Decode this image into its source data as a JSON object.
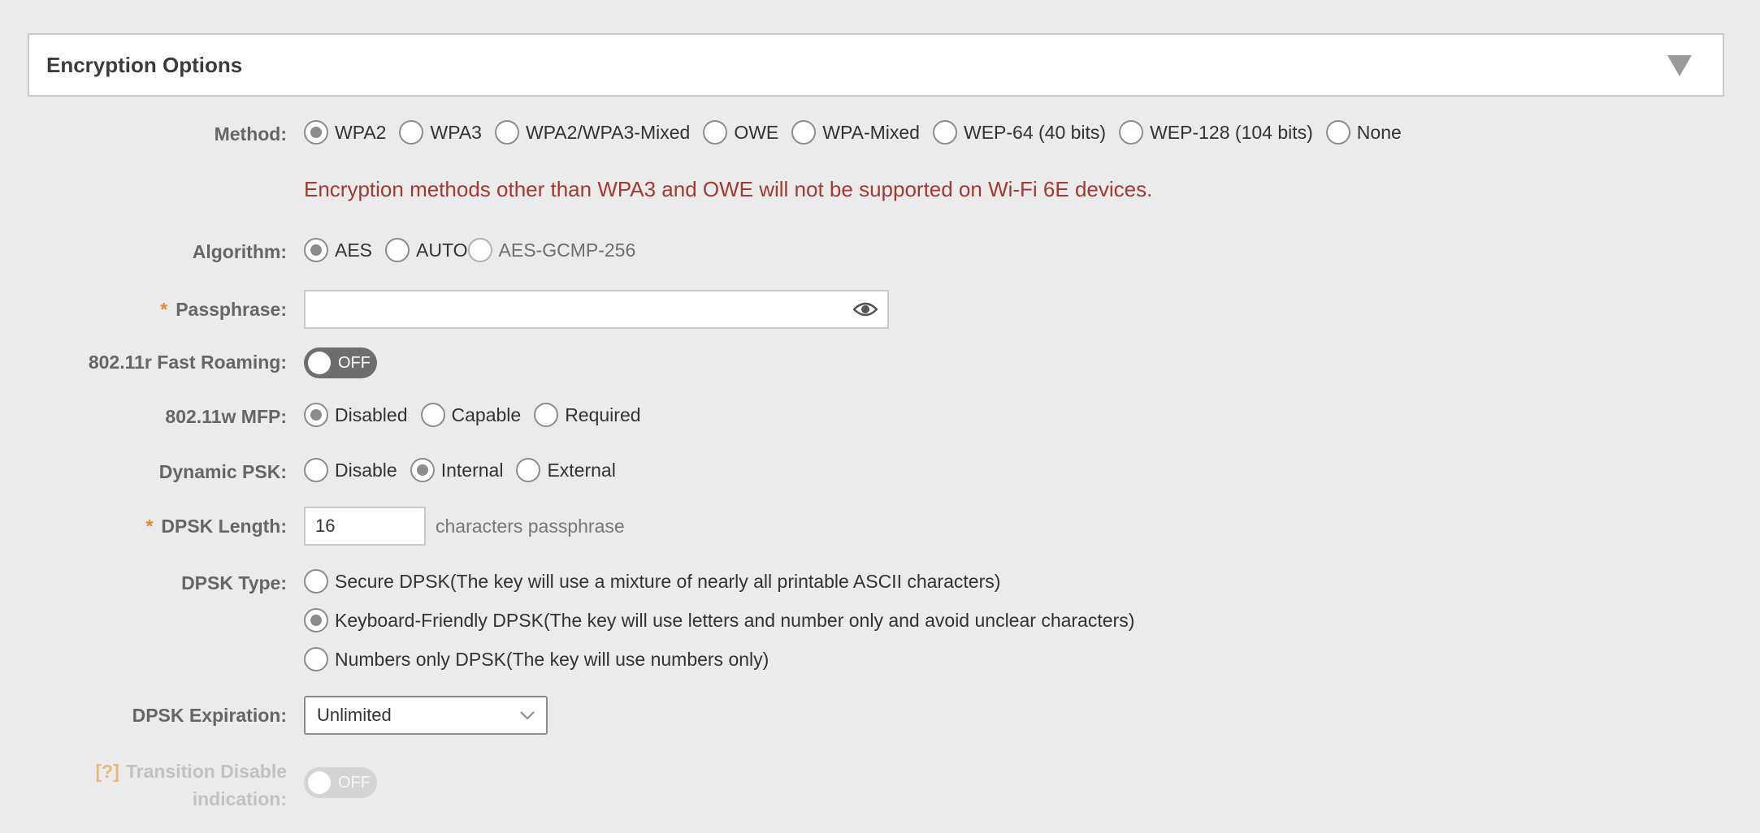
{
  "panel": {
    "title": "Encryption Options"
  },
  "method": {
    "label": "Method:",
    "options": [
      "WPA2",
      "WPA3",
      "WPA2/WPA3-Mixed",
      "OWE",
      "WPA-Mixed",
      "WEP-64 (40 bits)",
      "WEP-128 (104 bits)",
      "None"
    ],
    "selected": "WPA2"
  },
  "warning": "Encryption methods other than WPA3 and OWE will not be supported on Wi-Fi 6E devices.",
  "algorithm": {
    "label": "Algorithm:",
    "options": [
      "AES",
      "AUTO",
      "AES-GCMP-256"
    ],
    "selected": "AES"
  },
  "passphrase": {
    "required_mark": "*",
    "label": "Passphrase:",
    "value": ""
  },
  "fast_roaming": {
    "label": "802.11r Fast Roaming:",
    "state": "OFF"
  },
  "mfp": {
    "label": "802.11w MFP:",
    "options": [
      "Disabled",
      "Capable",
      "Required"
    ],
    "selected": "Disabled"
  },
  "dynamic_psk": {
    "label": "Dynamic PSK:",
    "options": [
      "Disable",
      "Internal",
      "External"
    ],
    "selected": "Internal"
  },
  "dpsk_length": {
    "required_mark": "*",
    "label": "DPSK Length:",
    "value": "16",
    "hint": "characters passphrase"
  },
  "dpsk_type": {
    "label": "DPSK Type:",
    "options": [
      "Secure DPSK(The key will use a mixture of nearly all printable ASCII characters)",
      "Keyboard-Friendly DPSK(The key will use letters and number only and avoid unclear characters)",
      "Numbers only DPSK(The key will use numbers only)"
    ],
    "selected_index": 1
  },
  "dpsk_expiration": {
    "label": "DPSK Expiration:",
    "value": "Unlimited"
  },
  "transition_disable": {
    "help": "[?]",
    "label_line1": "Transition Disable",
    "label_line2": "indication:",
    "state": "OFF"
  },
  "colors": {
    "warning": "#a33a32",
    "required": "#e38a2e",
    "toggle_off": "#6e6e6e"
  }
}
